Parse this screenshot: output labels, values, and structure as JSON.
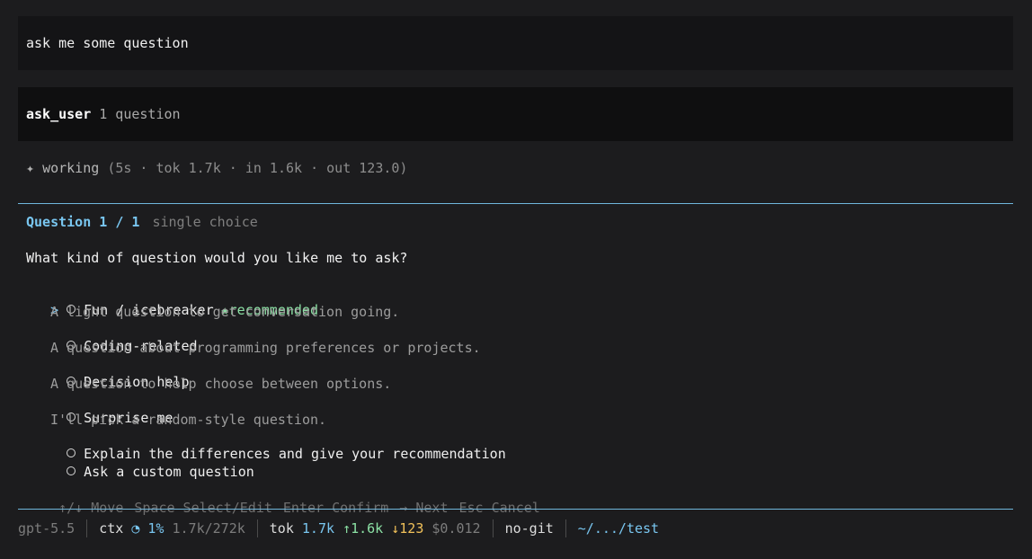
{
  "user_message": "ask me some question",
  "tool_call": {
    "name": "ask_user",
    "meta": "1 question"
  },
  "status": {
    "spinner": "✦",
    "word": "working",
    "details": "(5s · tok 1.7k · in 1.6k · out 123.0)"
  },
  "question": {
    "number": "Question 1 / 1",
    "type": "single choice",
    "text": "What kind of question would you like me to ask?",
    "cursor": ">",
    "recommended_label": "recommended",
    "options": [
      {
        "label": "Fun / icebreaker",
        "description": "A light question to get conversation going.",
        "recommended": true,
        "selected_cursor": true
      },
      {
        "label": "Coding-related",
        "description": "A question about programming preferences or projects."
      },
      {
        "label": "Decision help",
        "description": "A question to help choose between options."
      },
      {
        "label": "Surprise me",
        "description": "I'll pick a random-style question."
      },
      {
        "label": "Explain the differences and give your recommendation",
        "description": ""
      },
      {
        "label": "Ask a custom question",
        "description": ""
      }
    ]
  },
  "hints": [
    "↑/↓ Move",
    "Space Select/Edit",
    "Enter Confirm",
    "→ Next",
    "Esc Cancel"
  ],
  "footer": {
    "model": "gpt-5.5",
    "ctx_label": "ctx",
    "ctx_icon": "◔",
    "ctx_percent": "1%",
    "ctx_tokens": "1.7k/272k",
    "tok_label": "tok",
    "tok_total": "1.7k",
    "tok_in": "↑1.6k",
    "tok_out": "↓123",
    "cost": "$0.012",
    "git": "no-git",
    "path": "~/.../test"
  },
  "colors": {
    "accent": "#79c6f0",
    "recommended": "#8be0a4",
    "out_tokens": "#f1c15a"
  }
}
